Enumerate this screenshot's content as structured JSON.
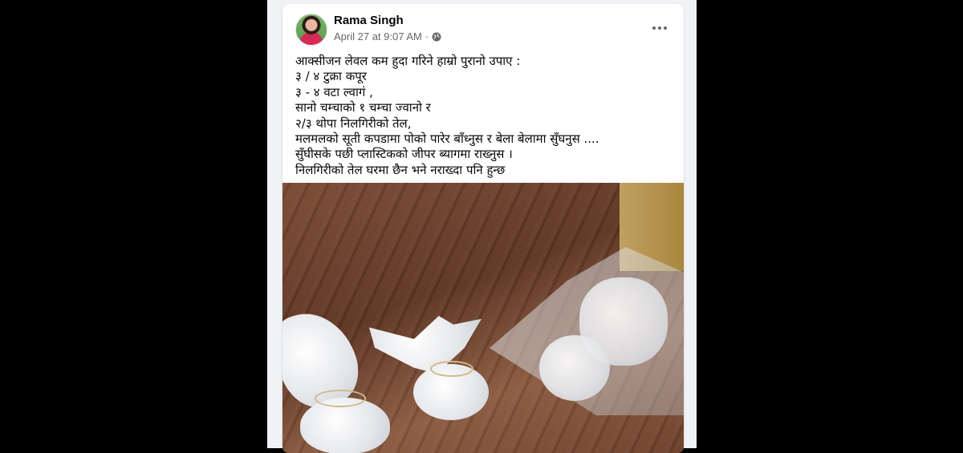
{
  "post": {
    "author": "Rama Singh",
    "date": "April 27 at 9:07 AM",
    "separator": "·",
    "audience_icon": "globe-icon",
    "more_icon": "more-horizontal-icon",
    "lines": [
      "आक्सीजन लेवल कम हुदा गरिने हाम्रो पुरानो उपाए :",
      "३ / ४ टुक्रा कपूर",
      "३ - ४ वटा ल्वागं ,",
      "सानो चम्चाको १ चम्चा ज्वानो र",
      "२/३ थोपा निलगिरीको तेल,",
      "मलमलको सूती कपडामा पोको पारेर बाँध्नुस र बेला बेलामा सुँघनुस ....",
      "सुँघीसके पछी प्लास्टिकको जीपर ब्यागमा राख्नुस ।",
      "निलगिरीको तेल घरमा छैन भने नराख्दा पनि हुन्छ"
    ]
  }
}
